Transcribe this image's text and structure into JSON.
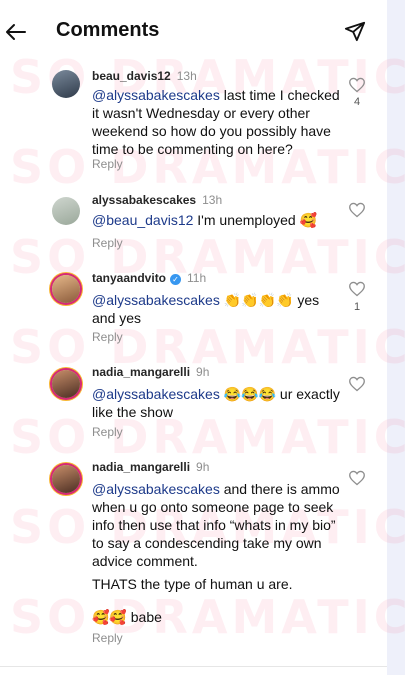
{
  "header": {
    "title": "Comments",
    "back_icon": "arrow-left-icon",
    "share_icon": "paper-plane-icon"
  },
  "watermark": {
    "text": "SO DRAMATIC!"
  },
  "comments": [
    {
      "username": "beau_davis12",
      "time": "13h",
      "mention": "@alyssabakescakes",
      "body": " last time I checked it wasn't Wednesday or every other weekend so how do you possibly have time to be commenting on here?",
      "reply": "Reply",
      "likes": "4",
      "verified": false
    },
    {
      "username": "alyssabakescakes",
      "time": "13h",
      "mention": "@beau_davis12",
      "body": " I'm unemployed 🥰",
      "reply": "Reply",
      "likes": "",
      "verified": false
    },
    {
      "username": "tanyaandvito",
      "time": "11h",
      "mention": "@alyssabakescakes",
      "body": " 👏👏👏👏 yes and yes",
      "reply": "Reply",
      "likes": "1",
      "verified": true
    },
    {
      "username": "nadia_mangarelli",
      "time": "9h",
      "mention": "@alyssabakescakes",
      "body": " 😂😂😂 ur exactly like the show",
      "reply": "Reply",
      "likes": "",
      "verified": false
    },
    {
      "username": "nadia_mangarelli",
      "time": "9h",
      "mention": "@alyssabakescakes",
      "body": " and there is ammo when u go onto someone page to seek info then use that info “whats in my bio” to say a condescending take my own advice comment.",
      "body2": "THATS the type of human u are.",
      "body3": "🥰🥰 babe",
      "reply": "Reply",
      "likes": "",
      "verified": false
    }
  ]
}
